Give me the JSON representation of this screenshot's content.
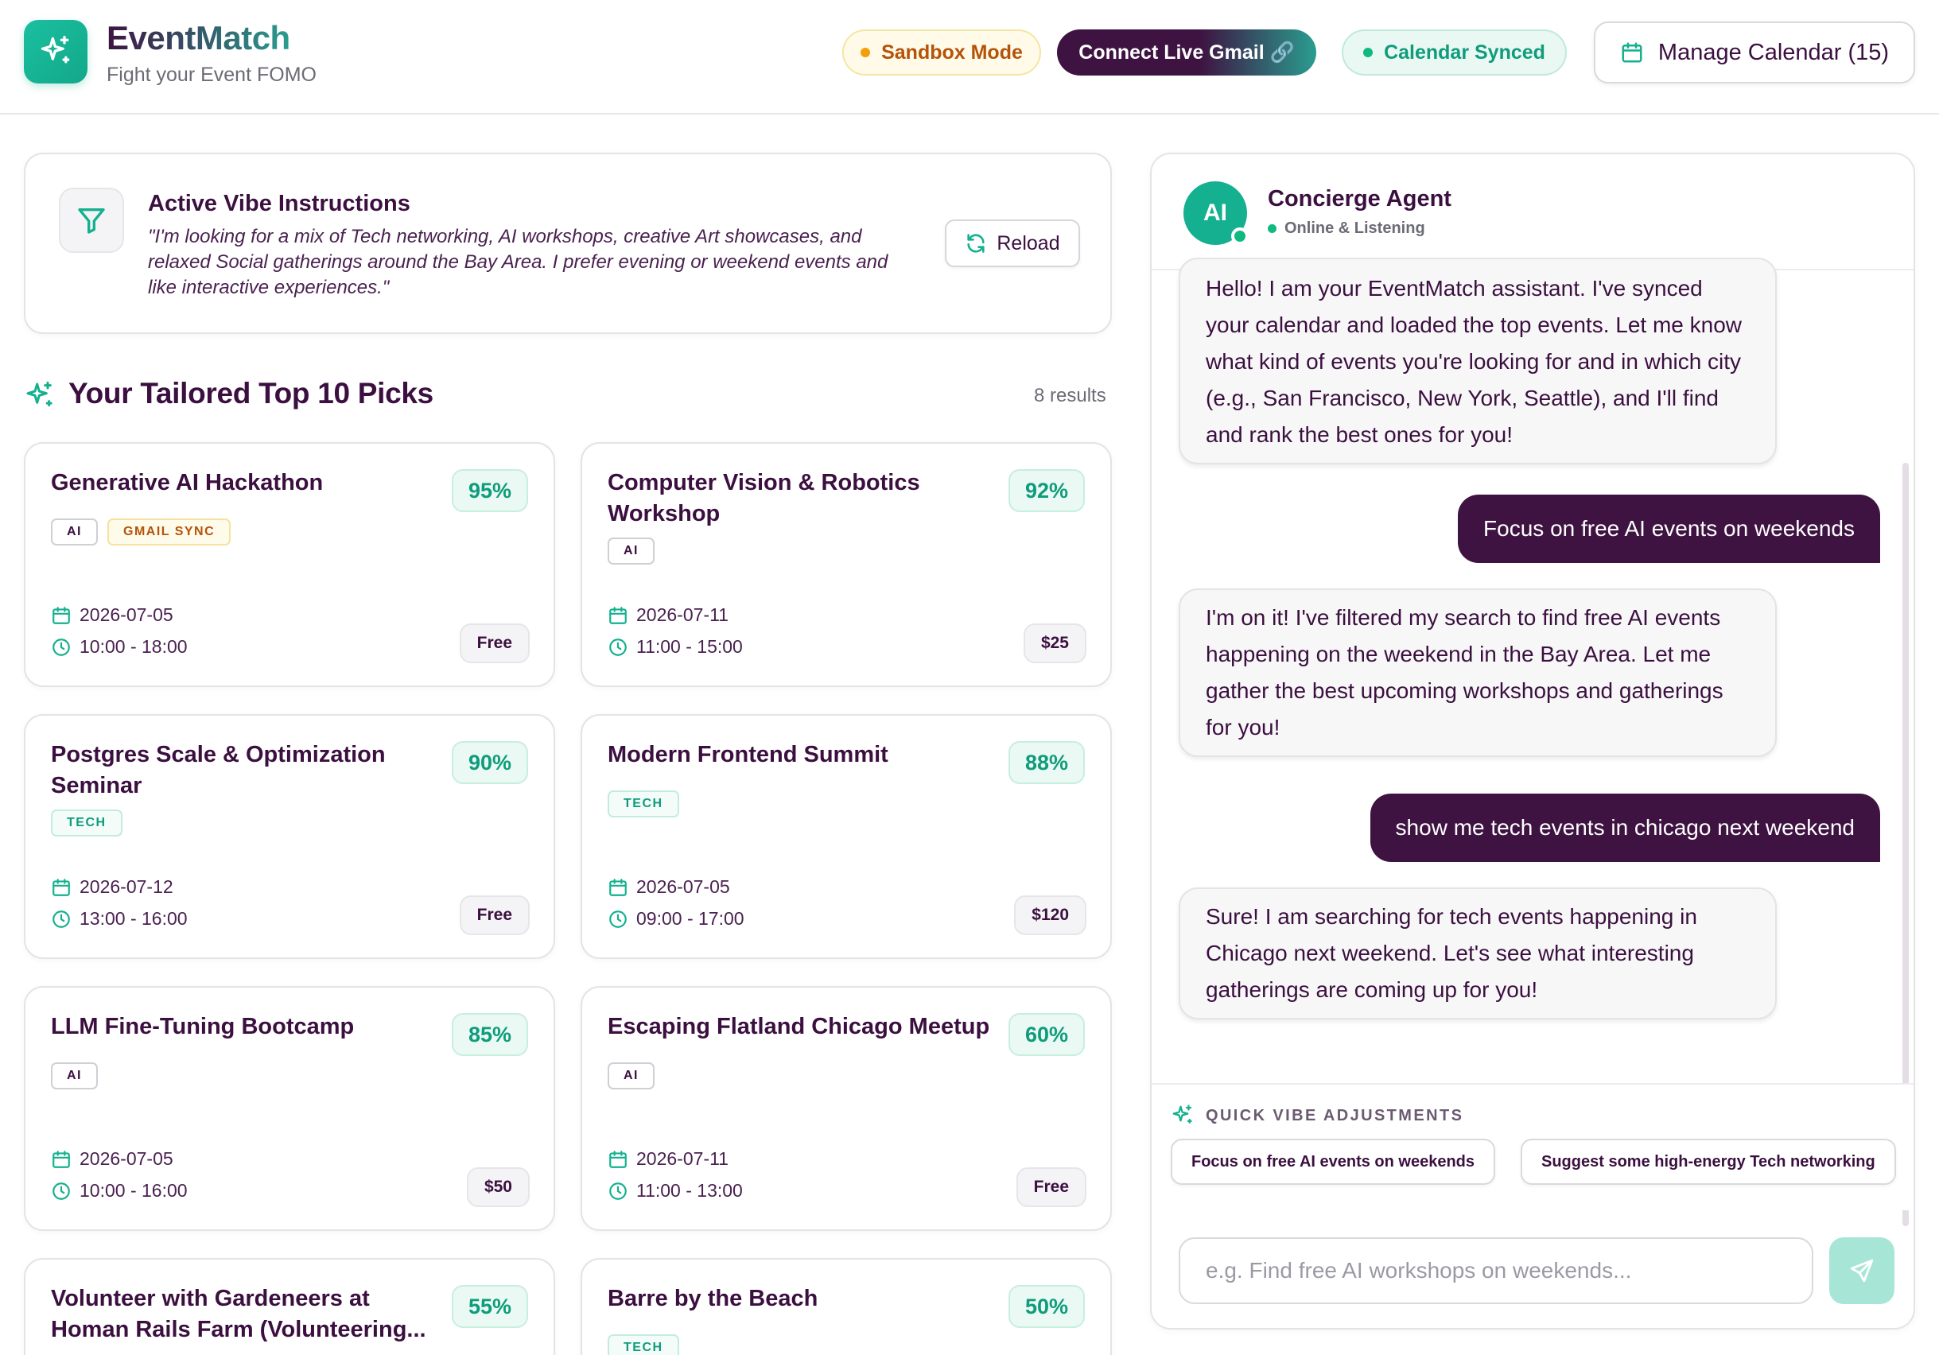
{
  "header": {
    "app_name": "EventMatch",
    "tagline": "Fight your Event FOMO",
    "sandbox_label": "Sandbox Mode",
    "gmail_label": "Connect Live Gmail 🔗",
    "synced_label": "Calendar Synced",
    "manage_calendar_label": "Manage Calendar (15)"
  },
  "vibe": {
    "title": "Active Vibe Instructions",
    "text": "\"I'm looking for a mix of Tech networking, AI workshops, creative Art showcases, and relaxed Social gatherings around the Bay Area. I prefer evening or weekend events and like interactive experiences.\"",
    "reload_label": "Reload"
  },
  "picks": {
    "title": "Your Tailored Top 10 Picks",
    "count": "8 results"
  },
  "events": [
    {
      "title": "Generative AI Hackathon",
      "match": "95%",
      "tags": [
        "AI",
        "GMAIL SYNC"
      ],
      "date": "2026-07-05",
      "time": "10:00 - 18:00",
      "price": "Free"
    },
    {
      "title": "Computer Vision & Robotics Workshop",
      "match": "92%",
      "tags": [
        "AI"
      ],
      "date": "2026-07-11",
      "time": "11:00 - 15:00",
      "price": "$25"
    },
    {
      "title": "Postgres Scale & Optimization Seminar",
      "match": "90%",
      "tags": [
        "TECH"
      ],
      "date": "2026-07-12",
      "time": "13:00 - 16:00",
      "price": "Free"
    },
    {
      "title": "Modern Frontend Summit",
      "match": "88%",
      "tags": [
        "TECH"
      ],
      "date": "2026-07-05",
      "time": "09:00 - 17:00",
      "price": "$120"
    },
    {
      "title": "LLM Fine-Tuning Bootcamp",
      "match": "85%",
      "tags": [
        "AI"
      ],
      "date": "2026-07-05",
      "time": "10:00 - 16:00",
      "price": "$50"
    },
    {
      "title": "Escaping Flatland Chicago Meetup",
      "match": "60%",
      "tags": [
        "AI"
      ],
      "date": "2026-07-11",
      "time": "11:00 - 13:00",
      "price": "Free"
    },
    {
      "title": "Volunteer with Gardeneers at Homan Rails Farm (Volunteering...",
      "match": "55%",
      "tags": [],
      "date": "",
      "time": "",
      "price": ""
    },
    {
      "title": "Barre by the Beach",
      "match": "50%",
      "tags": [
        "TECH"
      ],
      "date": "",
      "time": "",
      "price": ""
    }
  ],
  "chat": {
    "agent_name": "Concierge Agent",
    "agent_avatar": "AI",
    "agent_status": "Online & Listening",
    "messages": [
      {
        "role": "bot",
        "text": "Hello! I am your EventMatch assistant. I've synced your calendar and loaded the top events. Let me know what kind of events you're looking for and in which city (e.g., San Francisco, New York, Seattle), and I'll find and rank the best ones for you!"
      },
      {
        "role": "user",
        "text": "Focus on free AI events on weekends"
      },
      {
        "role": "bot",
        "text": "I'm on it! I've filtered my search to find free AI events happening on the weekend in the Bay Area. Let me gather the best upcoming workshops and gatherings for you!"
      },
      {
        "role": "user",
        "text": "show me tech events in chicago next weekend"
      },
      {
        "role": "bot",
        "text": "Sure! I am searching for tech events happening in Chicago next weekend. Let's see what interesting gatherings are coming up for you!"
      }
    ],
    "quick_label": "QUICK VIBE ADJUSTMENTS",
    "quick_chips": [
      "Focus on free AI events on weekends",
      "Suggest some high-energy Tech networking"
    ],
    "input_placeholder": "e.g. Find free AI workshops on weekends...",
    "input_value": ""
  },
  "colors": {
    "brand_purple": "#3e1342",
    "brand_teal": "#14b08f",
    "amber": "#b45309"
  },
  "icons": {
    "logo": "sparkles-icon",
    "calendar": "calendar-icon",
    "filter": "filter-icon",
    "reload": "refresh-icon",
    "clock": "clock-icon",
    "send": "send-icon",
    "link": "link-icon"
  }
}
